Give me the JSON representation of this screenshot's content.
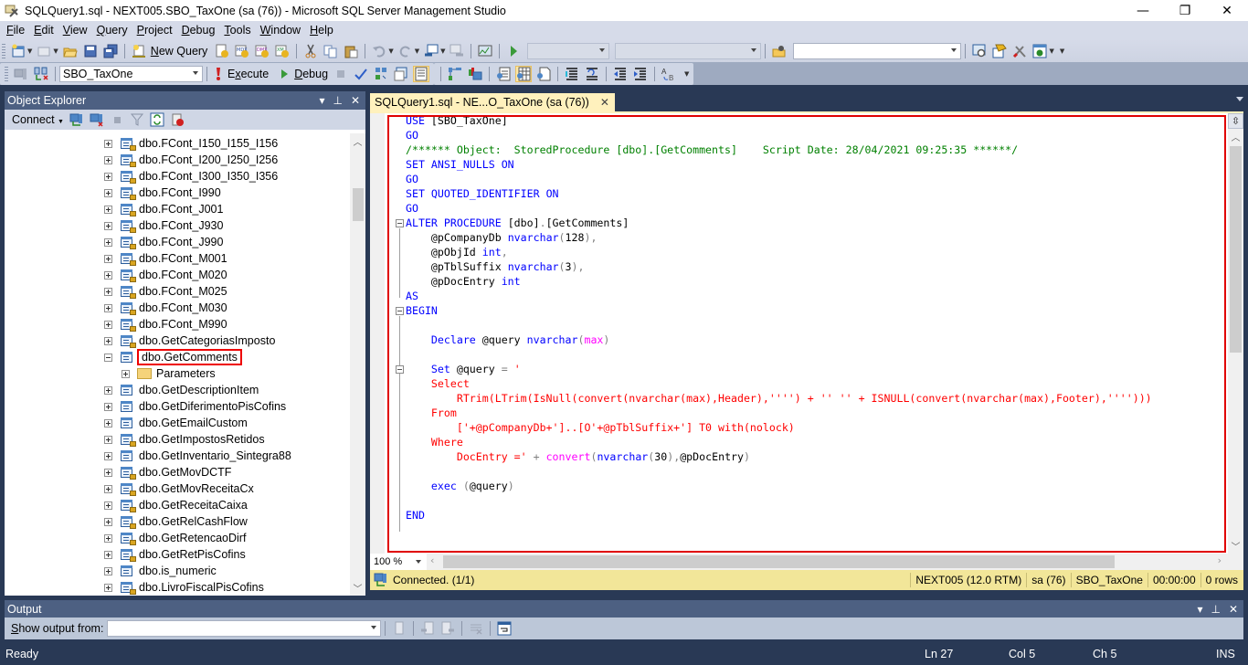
{
  "window": {
    "title": "SQLQuery1.sql - NEXT005.SBO_TaxOne (sa (76)) - Microsoft SQL Server Management Studio",
    "minimize": "—",
    "restore": "❐",
    "close": "✕"
  },
  "menu": [
    {
      "label": "File",
      "accel": "F",
      "rest": "ile"
    },
    {
      "label": "Edit",
      "accel": "E",
      "rest": "dit"
    },
    {
      "label": "View",
      "accel": "V",
      "rest": "iew"
    },
    {
      "label": "Query",
      "accel": "Q",
      "rest": "uery"
    },
    {
      "label": "Project",
      "accel": "P",
      "rest": "roject"
    },
    {
      "label": "Debug",
      "accel": "D",
      "rest": "ebug"
    },
    {
      "label": "Tools",
      "accel": "T",
      "rest": "ools"
    },
    {
      "label": "Window",
      "accel": "W",
      "rest": "indow"
    },
    {
      "label": "Help",
      "accel": "H",
      "rest": "elp"
    }
  ],
  "toolbar1": {
    "new_query_label": "New Query",
    "new_query_accel": "N",
    "new_query_rest": "ew Query",
    "solution_config": "",
    "solution_platform": "",
    "find_input": ""
  },
  "toolbar2": {
    "database": "SBO_TaxOne",
    "execute_label": "Execute",
    "execute_accel": "x",
    "debug_label": "Debug",
    "debug_accel": "D"
  },
  "object_explorer": {
    "title": "Object Explorer",
    "connect_label": "Connect",
    "nodes": [
      {
        "label": "dbo.FCont_I150_I155_I156",
        "expanded": false,
        "locked": true
      },
      {
        "label": "dbo.FCont_I200_I250_I256",
        "expanded": false,
        "locked": true
      },
      {
        "label": "dbo.FCont_I300_I350_I356",
        "expanded": false,
        "locked": true
      },
      {
        "label": "dbo.FCont_I990",
        "expanded": false,
        "locked": true
      },
      {
        "label": "dbo.FCont_J001",
        "expanded": false,
        "locked": true
      },
      {
        "label": "dbo.FCont_J930",
        "expanded": false,
        "locked": true
      },
      {
        "label": "dbo.FCont_J990",
        "expanded": false,
        "locked": true
      },
      {
        "label": "dbo.FCont_M001",
        "expanded": false,
        "locked": true
      },
      {
        "label": "dbo.FCont_M020",
        "expanded": false,
        "locked": true
      },
      {
        "label": "dbo.FCont_M025",
        "expanded": false,
        "locked": true
      },
      {
        "label": "dbo.FCont_M030",
        "expanded": false,
        "locked": true
      },
      {
        "label": "dbo.FCont_M990",
        "expanded": false,
        "locked": true
      },
      {
        "label": "dbo.GetCategoriasImposto",
        "expanded": false,
        "locked": true
      },
      {
        "label": "dbo.GetComments",
        "expanded": true,
        "locked": false,
        "selected": true
      },
      {
        "label": "Parameters",
        "expanded": false,
        "folder": true
      },
      {
        "label": "dbo.GetDescriptionItem",
        "expanded": false,
        "locked": false
      },
      {
        "label": "dbo.GetDiferimentoPisCofins",
        "expanded": false,
        "locked": false
      },
      {
        "label": "dbo.GetEmailCustom",
        "expanded": false,
        "locked": false
      },
      {
        "label": "dbo.GetImpostosRetidos",
        "expanded": false,
        "locked": true
      },
      {
        "label": "dbo.GetInventario_Sintegra88",
        "expanded": false,
        "locked": false
      },
      {
        "label": "dbo.GetMovDCTF",
        "expanded": false,
        "locked": true
      },
      {
        "label": "dbo.GetMovReceitaCx",
        "expanded": false,
        "locked": true
      },
      {
        "label": "dbo.GetReceitaCaixa",
        "expanded": false,
        "locked": true
      },
      {
        "label": "dbo.GetRelCashFlow",
        "expanded": false,
        "locked": true
      },
      {
        "label": "dbo.GetRetencaoDirf",
        "expanded": false,
        "locked": true
      },
      {
        "label": "dbo.GetRetPisCofins",
        "expanded": false,
        "locked": true
      },
      {
        "label": "dbo.is_numeric",
        "expanded": false,
        "locked": false
      },
      {
        "label": "dbo.LivroFiscalPisCofins",
        "expanded": false,
        "locked": true
      }
    ]
  },
  "document_tab": {
    "label": "SQLQuery1.sql - NE...O_TaxOne (sa (76))",
    "close": "✕"
  },
  "editor": {
    "lines": [
      [
        [
          "kw",
          "USE "
        ],
        [
          "",
          "[SBO_TaxOne]"
        ]
      ],
      [
        [
          "kw",
          "GO"
        ]
      ],
      [
        [
          "cm",
          "/****** Object:  StoredProcedure [dbo].[GetComments]    Script Date: 28/04/2021 09:25:35 ******/"
        ]
      ],
      [
        [
          "kw",
          "SET "
        ],
        [
          "kw",
          "ANSI_NULLS "
        ],
        [
          "kw",
          "ON"
        ]
      ],
      [
        [
          "kw",
          "GO"
        ]
      ],
      [
        [
          "kw",
          "SET "
        ],
        [
          "kw",
          "QUOTED_IDENTIFIER "
        ],
        [
          "kw",
          "ON"
        ]
      ],
      [
        [
          "kw",
          "GO"
        ]
      ],
      [
        [
          "kw",
          "ALTER PROCEDURE "
        ],
        [
          "",
          "[dbo]"
        ],
        [
          "op",
          "."
        ],
        [
          "",
          "[GetComments]"
        ]
      ],
      [
        [
          "",
          "    @pCompanyDb "
        ],
        [
          "kw",
          "nvarchar"
        ],
        [
          "op",
          "("
        ],
        [
          "",
          "128"
        ],
        [
          "op",
          "),"
        ]
      ],
      [
        [
          "",
          "    @pObjId "
        ],
        [
          "kw",
          "int"
        ],
        [
          "op",
          ","
        ]
      ],
      [
        [
          "",
          "    @pTblSuffix "
        ],
        [
          "kw",
          "nvarchar"
        ],
        [
          "op",
          "("
        ],
        [
          "",
          "3"
        ],
        [
          "op",
          "),"
        ]
      ],
      [
        [
          "",
          "    @pDocEntry "
        ],
        [
          "kw",
          "int"
        ]
      ],
      [
        [
          "kw",
          "AS"
        ]
      ],
      [
        [
          "kw",
          "BEGIN"
        ]
      ],
      [],
      [
        [
          "",
          "    "
        ],
        [
          "kw",
          "Declare "
        ],
        [
          "",
          "@query "
        ],
        [
          "kw",
          "nvarchar"
        ],
        [
          "op",
          "("
        ],
        [
          "fn",
          "max"
        ],
        [
          "op",
          ")"
        ]
      ],
      [],
      [
        [
          "",
          "    "
        ],
        [
          "kw",
          "Set "
        ],
        [
          "",
          "@query "
        ],
        [
          "op",
          "= "
        ],
        [
          "st",
          "'"
        ]
      ],
      [
        [
          "st",
          "    Select"
        ]
      ],
      [
        [
          "st",
          "        RTrim(LTrim(IsNull(convert(nvarchar(max),Header),'''') + '' '' + ISNULL(convert(nvarchar(max),Footer),'''')))"
        ]
      ],
      [
        [
          "st",
          "    From"
        ]
      ],
      [
        [
          "st",
          "        ['+@pCompanyDb+']..[O'+@pTblSuffix+'] T0 with(nolock)"
        ]
      ],
      [
        [
          "st",
          "    Where"
        ]
      ],
      [
        [
          "st",
          "        DocEntry ='"
        ],
        [
          "op",
          " + "
        ],
        [
          "fn",
          "convert"
        ],
        [
          "op",
          "("
        ],
        [
          "kw",
          "nvarchar"
        ],
        [
          "op",
          "("
        ],
        [
          "",
          "30"
        ],
        [
          "op",
          "),"
        ],
        [
          "",
          "@pDocEntry"
        ],
        [
          "op",
          ")"
        ]
      ],
      [],
      [
        [
          "",
          "    "
        ],
        [
          "kw",
          "exec "
        ],
        [
          "op",
          "("
        ],
        [
          "",
          "@query"
        ],
        [
          "op",
          ")"
        ]
      ],
      [],
      [
        [
          "kw",
          "END"
        ]
      ]
    ]
  },
  "editor_footer": {
    "zoom": "100 %"
  },
  "query_status": {
    "connection": "Connected. (1/1)",
    "server": "NEXT005 (12.0 RTM)",
    "user": "sa (76)",
    "database": "SBO_TaxOne",
    "elapsed": "00:00:00",
    "rows": "0 rows"
  },
  "output": {
    "title": "Output",
    "show_output_from_label": "Show output from:",
    "show_output_from_accel": "S",
    "show_output_from_rest": "how output from:",
    "source": ""
  },
  "statusbar": {
    "ready": "Ready",
    "line": "Ln 27",
    "col": "Col 5",
    "ch": "Ch 5",
    "mode": "INS"
  },
  "colors": {
    "keyword": "#0000ff",
    "comment": "#008000",
    "string": "#ff0000",
    "function": "#ff00ff",
    "highlight_box": "#e00000",
    "tab_active": "#fff1bd",
    "query_status_bg": "#f2e699",
    "chrome_dark": "#293955"
  }
}
